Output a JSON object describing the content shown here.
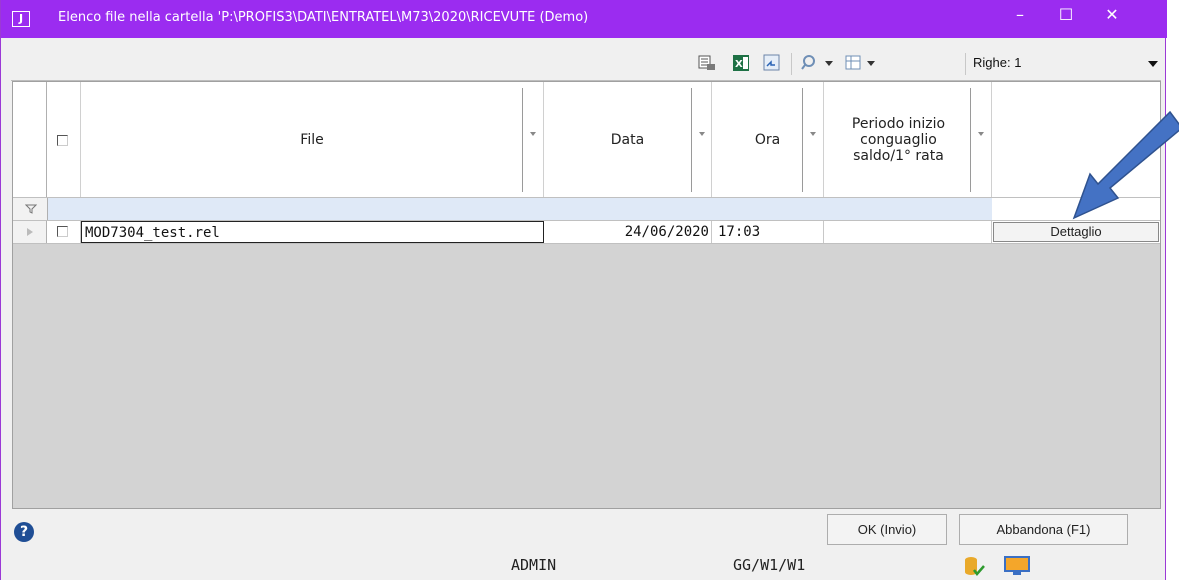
{
  "window": {
    "title": "Elenco file nella cartella 'P:\\PROFIS3\\DATI\\ENTRATEL\\M73\\2020\\RICEVUTE  (Demo)",
    "app_icon_label": "J",
    "minimize_glyph": "–",
    "maximize_glyph": "☐",
    "close_glyph": "✕"
  },
  "toolbar": {
    "icons": [
      "print-preview-icon",
      "excel-icon",
      "export-icon",
      "search-filter-icon",
      "column-chooser-icon"
    ],
    "rows_label": "Righe: 1"
  },
  "grid": {
    "columns": [
      {
        "label": "File"
      },
      {
        "label": "Data"
      },
      {
        "label": "Ora"
      },
      {
        "label": "Periodo inizio conguaglio saldo/1° rata"
      }
    ],
    "rows": [
      {
        "file": "MOD7304_test.rel",
        "data": "24/06/2020",
        "ora": "17:03",
        "periodo": "",
        "action": "Dettaglio"
      }
    ]
  },
  "footer": {
    "help_glyph": "?",
    "ok_label": "OK (Invio)",
    "cancel_label": "Abbandona (F1)"
  },
  "statusbar": {
    "user": "ADMIN",
    "workstation": "GG/W1/W1"
  },
  "colors": {
    "titlebar": "#9b2cf0",
    "filter_row": "#dfe9f7",
    "annotation_arrow": "#4472c4"
  }
}
